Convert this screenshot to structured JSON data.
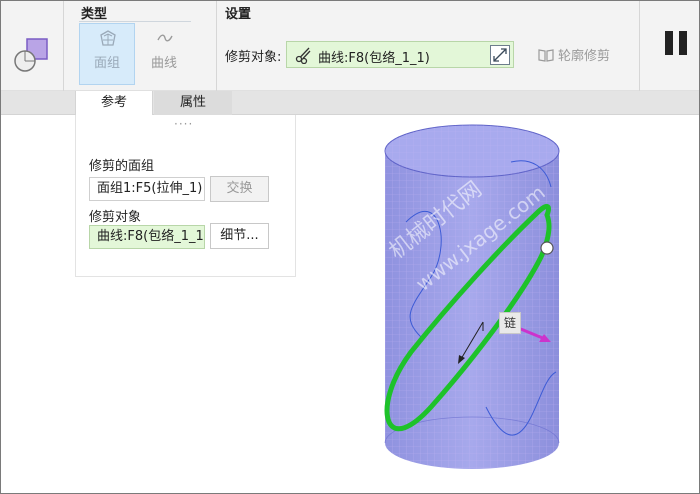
{
  "ribbon": {
    "type_group_title": "类型",
    "settings_group_title": "设置",
    "types": [
      {
        "label": "面组",
        "icon": "quilt-icon",
        "active": true
      },
      {
        "label": "曲线",
        "icon": "curve-icon",
        "active": false
      }
    ],
    "trim_object_label": "修剪对象:",
    "trim_object_value": "曲线:F8(包络_1_1)",
    "contour_trim_label": "轮廓修剪"
  },
  "tabs": [
    {
      "label": "参考",
      "active": true
    },
    {
      "label": "属性",
      "active": false
    }
  ],
  "panel": {
    "drag_handle": "····",
    "trimmed_quilt_label": "修剪的面组",
    "trimmed_quilt_value": "面组1:F5(拉伸_1)",
    "swap_button": "交换",
    "trim_object_label": "修剪对象",
    "trim_object_value": "曲线:F8(包络_1_1)",
    "details_button": "细节..."
  },
  "viewport": {
    "chain_tag": "链",
    "watermark_line1": "机械时代网",
    "watermark_line2": "www.jxage.com",
    "colors": {
      "surface": "#9d9fe6",
      "trim_curve": "#1ec22a",
      "direction_arrow": "#cc33cc"
    }
  }
}
